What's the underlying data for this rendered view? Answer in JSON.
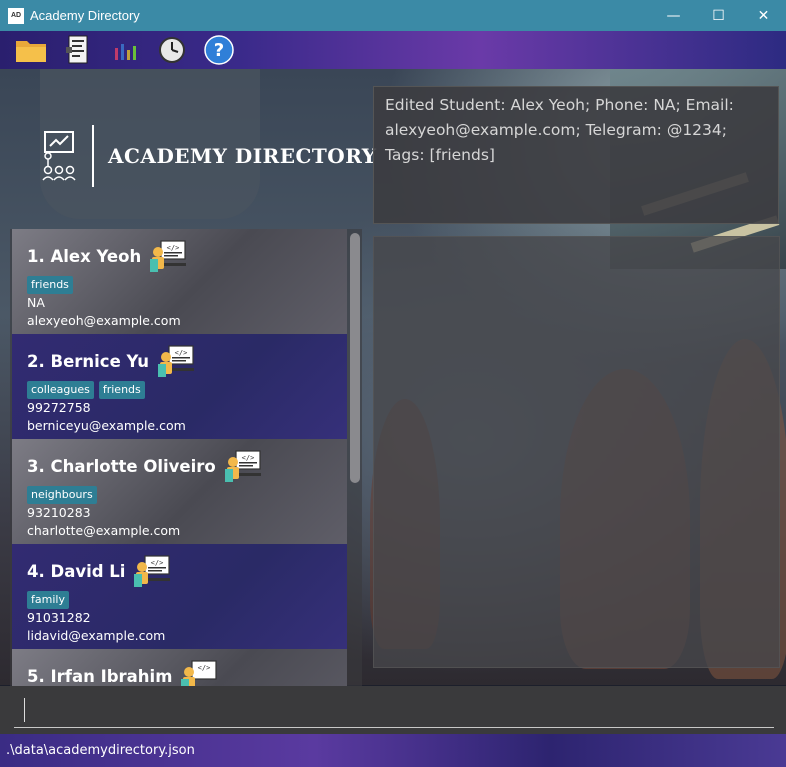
{
  "window": {
    "title": "Academy Directory",
    "app_icon_text": "AD",
    "controls": {
      "minimize": "—",
      "maximize": "☐",
      "close": "✕"
    }
  },
  "toolbar": {
    "items": [
      {
        "icon": "folder-icon"
      },
      {
        "icon": "document-icon"
      },
      {
        "icon": "chart-icon"
      },
      {
        "icon": "clock-icon"
      },
      {
        "icon": "help-icon"
      }
    ]
  },
  "logo": {
    "text": "ACADEMY DIRECTORY"
  },
  "result_display": {
    "text": "Edited Student: Alex Yeoh; Phone: NA; Email: alexyeoh@example.com; Telegram: @1234; Tags: [friends]"
  },
  "students": [
    {
      "name": "1.  Alex Yeoh",
      "tags": [
        "friends"
      ],
      "phone": "NA",
      "email": "alexyeoh@example.com"
    },
    {
      "name": "2.  Bernice Yu",
      "tags": [
        "colleagues",
        "friends"
      ],
      "phone": "99272758",
      "email": "berniceyu@example.com"
    },
    {
      "name": "3.  Charlotte Oliveiro",
      "tags": [
        "neighbours"
      ],
      "phone": "93210283",
      "email": "charlotte@example.com"
    },
    {
      "name": "4.  David Li",
      "tags": [
        "family"
      ],
      "phone": "91031282",
      "email": "lidavid@example.com"
    },
    {
      "name": "5.  Irfan Ibrahim",
      "tags": [],
      "phone": "",
      "email": ""
    }
  ],
  "command": {
    "value": "",
    "placeholder": ""
  },
  "status_bar": {
    "path": ".\\data\\academydirectory.json"
  },
  "colors": {
    "titlebar": "#3b8aa6",
    "tag": "#2e7e94",
    "card_dark": "#2a2a66"
  }
}
